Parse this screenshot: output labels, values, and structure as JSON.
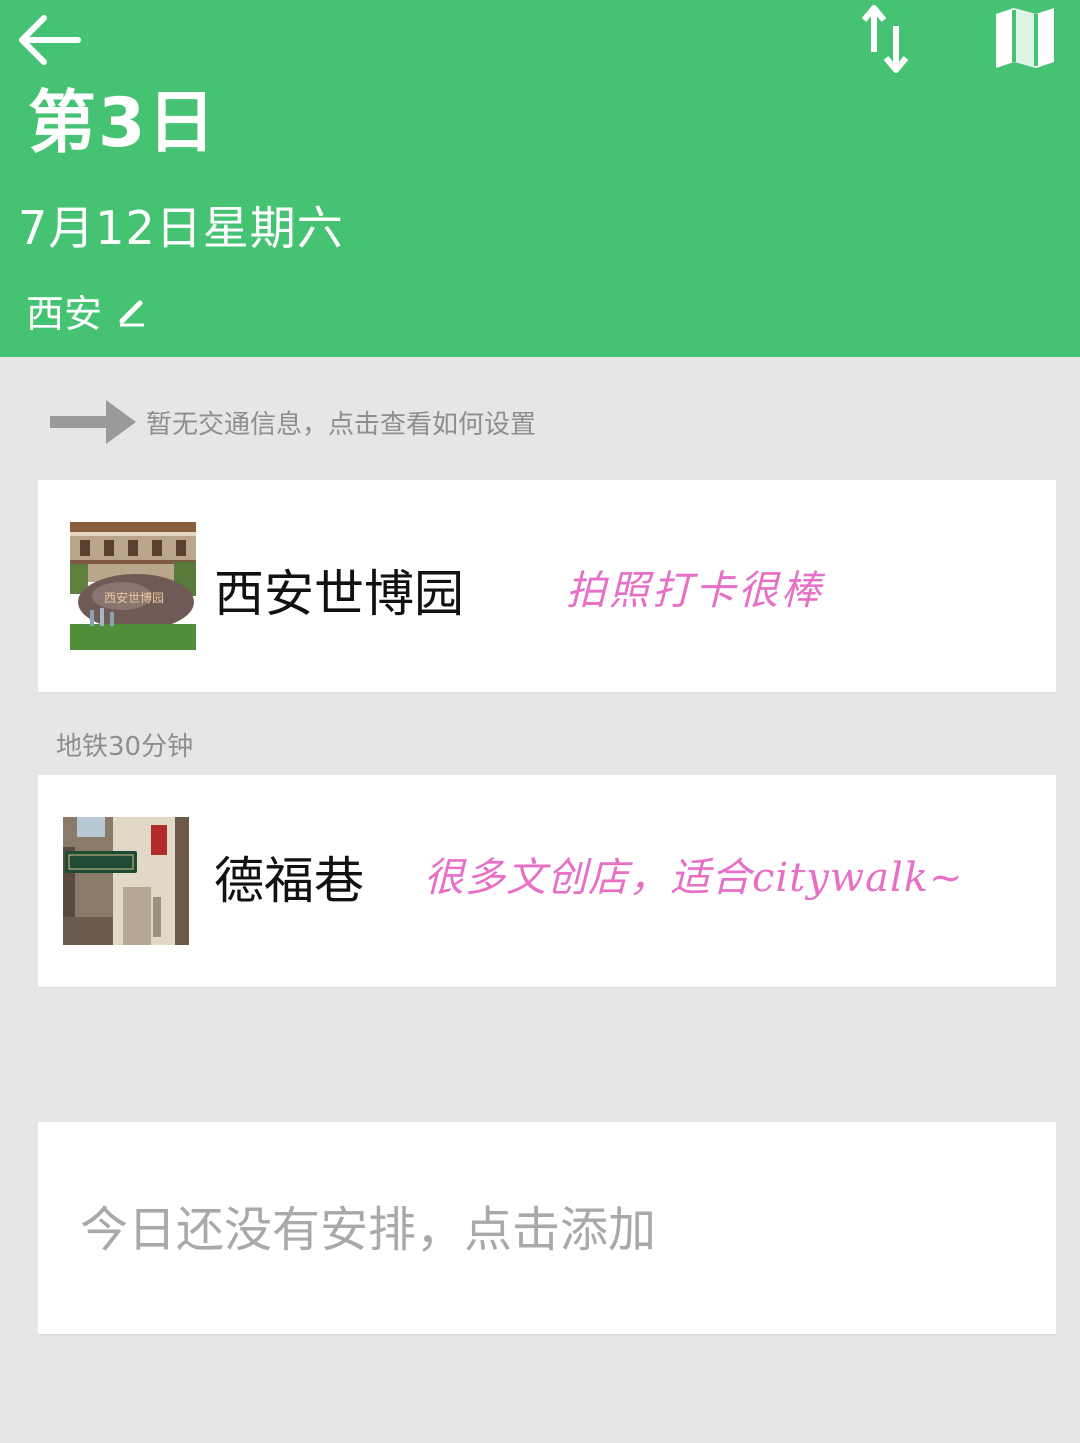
{
  "header": {
    "day_title": "第3日",
    "date": "7月12日星期六",
    "city": "西安",
    "background_color": "#45c373",
    "icons": [
      "arrow-left-icon",
      "sort-arrows-icon",
      "map-icon",
      "pencil-icon"
    ]
  },
  "transport_hint": {
    "text": "暂无交通信息，点击查看如何设置",
    "icon": "arrow-right-icon"
  },
  "itinerary": [
    {
      "name": "西安世博园",
      "note": "拍照打卡很棒",
      "image": "photo-xian-expo-park",
      "image_sign_text": "西安世博园"
    },
    {
      "name": "德福巷",
      "note": "很多文创店，适合citywalk~",
      "image": "photo-defu-lane"
    }
  ],
  "commute_between": "地铁30分钟",
  "empty_prompt": "今日还没有安排，点击添加",
  "accent_colors": {
    "note_text": "#e86fc6",
    "hint_text": "#8e8e8e"
  }
}
